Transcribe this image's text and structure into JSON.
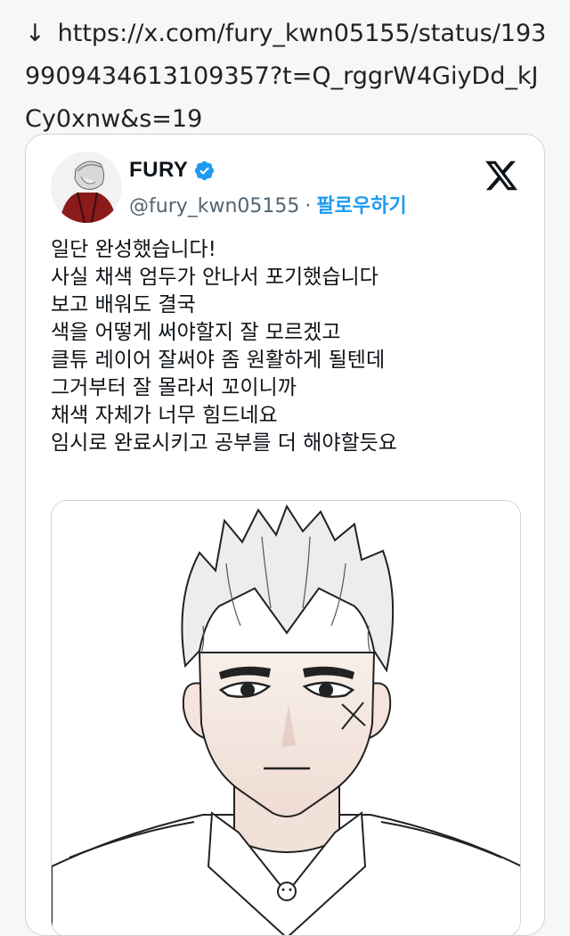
{
  "share_link": {
    "arrow": "↓",
    "url": "https://x.com/fury_kwn05155/status/1939909434613109357?t=Q_rggrW4GiyDd_kJCy0xnw&s=19"
  },
  "tweet": {
    "display_name": "FURY",
    "handle": "@fury_kwn05155",
    "separator": "·",
    "follow_label": "팔로우하기",
    "verified_icon": "verified-badge-icon",
    "platform_icon": "x-logo-icon",
    "lines": [
      "일단 완성했습니다!",
      "사실 채색 엄두가 안나서 포기했습니다",
      "보고 배워도 결국",
      "색을 어떻게 써야할지 잘 모르겠고",
      "클튜 레이어 잘써야 좀 원활하게 될텐데",
      "그거부터 잘 몰라서 꼬이니까",
      "채색 자체가 너무 힘드네요",
      "임시로 완료시키고 공부를 더 해야할듯요"
    ]
  },
  "colors": {
    "accent": "#1d9bf0",
    "secondary_text": "#536471",
    "primary_text": "#0f1419"
  }
}
